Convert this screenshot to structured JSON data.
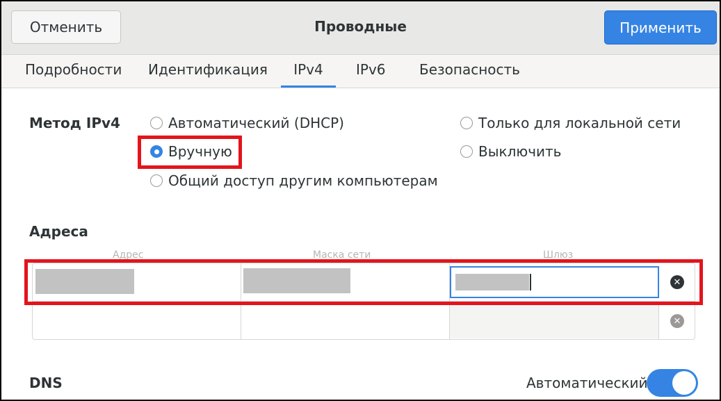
{
  "header": {
    "cancel_label": "Отменить",
    "title": "Проводные",
    "apply_label": "Применить"
  },
  "tabs": [
    {
      "label": "Подробности"
    },
    {
      "label": "Идентификация"
    },
    {
      "label": "IPv4",
      "active": true
    },
    {
      "label": "IPv6"
    },
    {
      "label": "Безопасность"
    }
  ],
  "ipv4_method": {
    "label": "Метод IPv4",
    "options": {
      "auto": "Автоматический (DHCP)",
      "manual": "Вручную",
      "shared": "Общий доступ другим компьютерам",
      "local": "Только для локальной сети",
      "disabled": "Выключить"
    },
    "selected": "manual"
  },
  "addresses": {
    "section_label": "Адреса",
    "columns": [
      "Адрес",
      "Маска сети",
      "Шлюз"
    ]
  },
  "dns": {
    "label": "DNS",
    "auto_label": "Автоматический",
    "auto_enabled": true
  },
  "colors": {
    "accent": "#3584e4",
    "highlight": "#e3141c"
  }
}
